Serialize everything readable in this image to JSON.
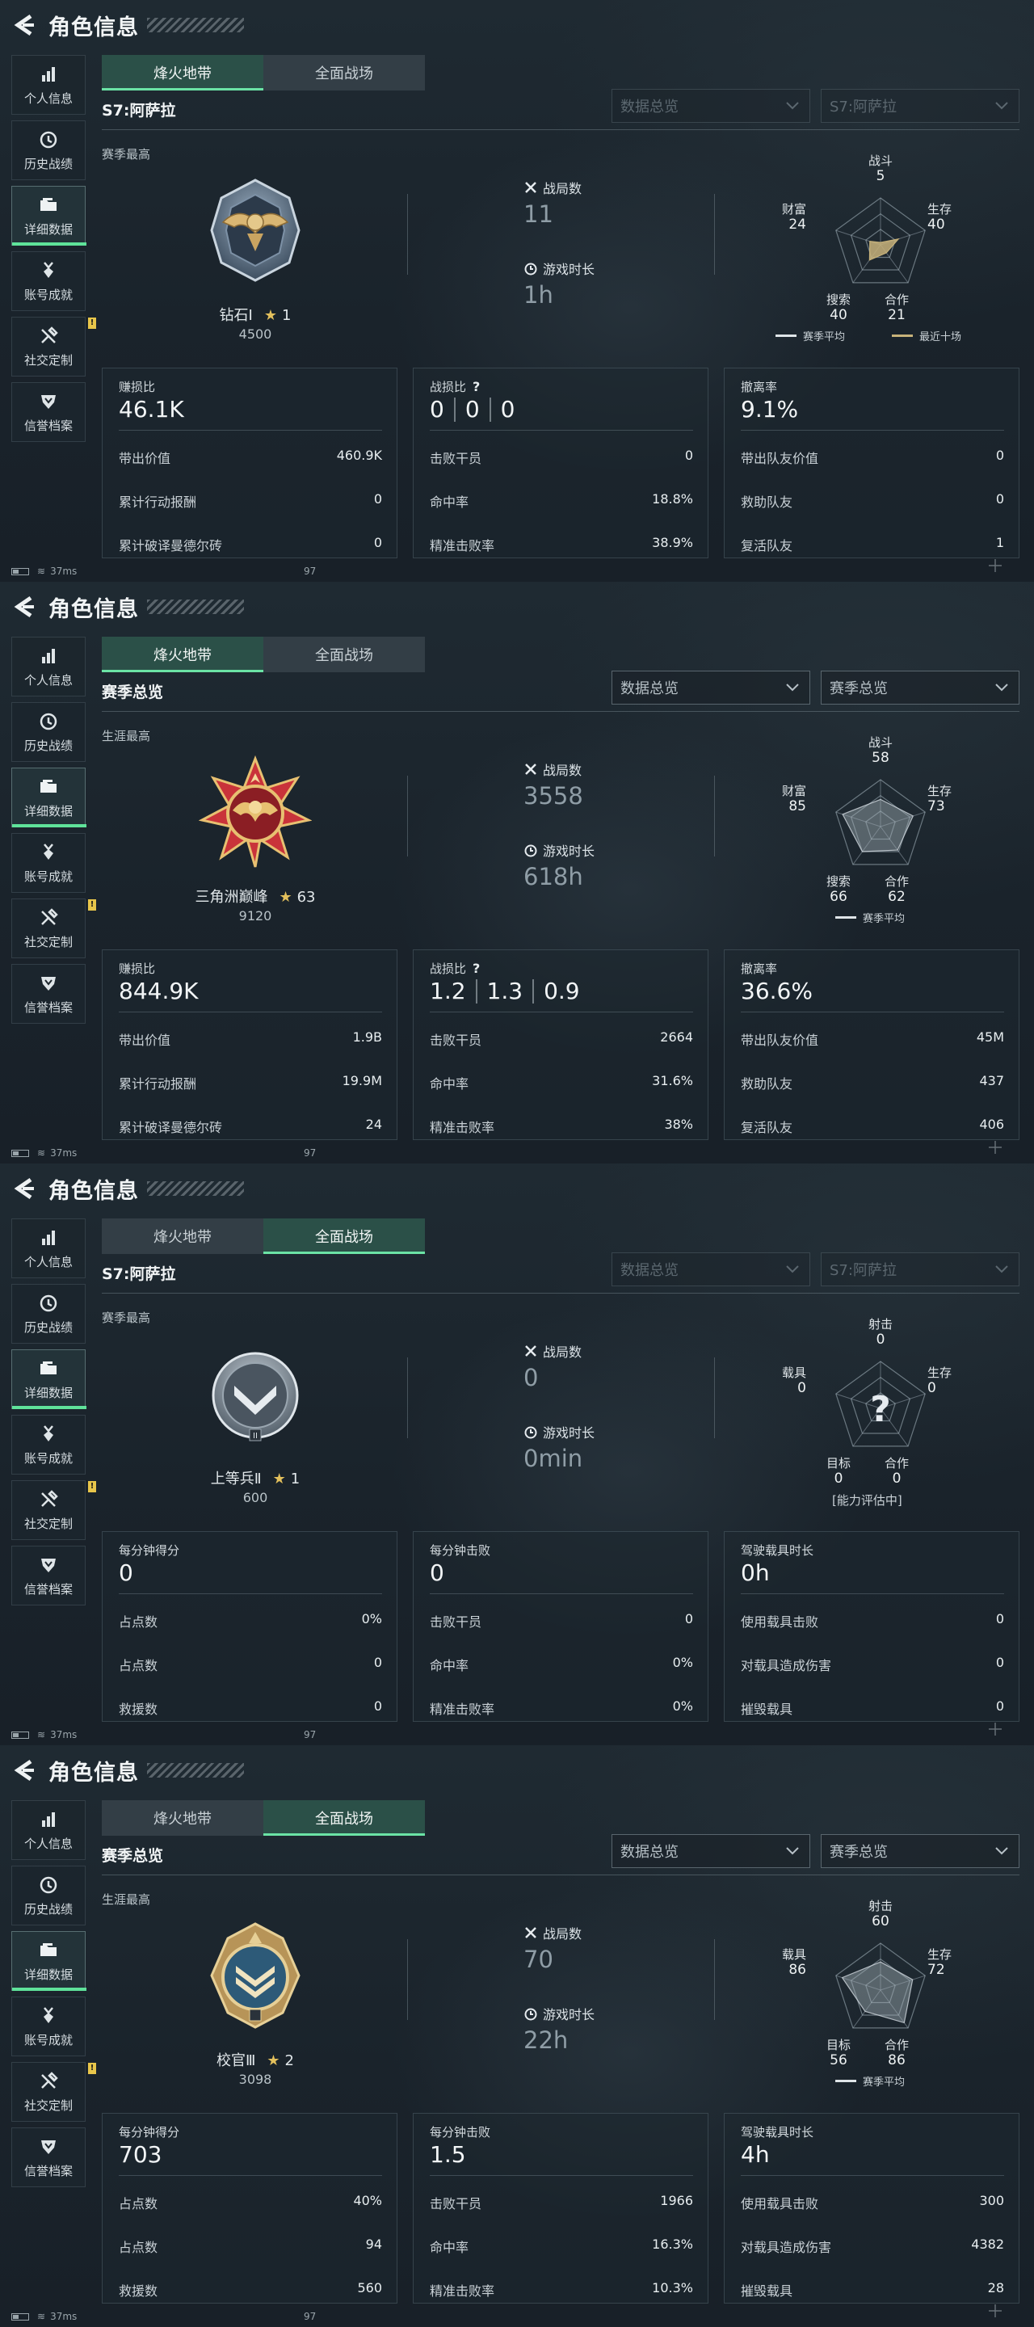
{
  "panels": [
    {
      "title": "角色信息",
      "sidebar": [
        "个人信息",
        "历史战绩",
        "详细数据",
        "账号成就",
        "社交定制",
        "信誉档案"
      ],
      "tabs": [
        "烽火地带",
        "全面战场"
      ],
      "subheader": "S7:阿萨拉",
      "dropdowns": [
        "数据总览",
        "S7:阿萨拉"
      ],
      "best_label": "赛季最高",
      "rank_name": "钻石Ⅰ",
      "rank_stars": "1",
      "rank_score": "4500",
      "stat1_label": "战局数",
      "stat1_value": "11",
      "stat2_label": "游戏时长",
      "stat2_value": "1h",
      "radar": {
        "top": "战斗",
        "top_v": "5",
        "right": "生存",
        "right_v": "40",
        "bottom_right": "合作",
        "bottom_right_v": "21",
        "bottom_left": "搜索",
        "bottom_left_v": "40",
        "left": "财富",
        "left_v": "24"
      },
      "legend1": "赛季平均",
      "legend2": "最近十场",
      "cards": [
        {
          "title": "赚损比",
          "value": "46.1K",
          "rows": [
            [
              "带出价值",
              "460.9K"
            ],
            [
              "累计行动报酬",
              "0"
            ],
            [
              "累计破译曼德尔砖",
              "0"
            ]
          ]
        },
        {
          "title": "战损比",
          "v1": "0",
          "v2": "0",
          "v3": "0",
          "rows": [
            [
              "击败干员",
              "0"
            ],
            [
              "命中率",
              "18.8%"
            ],
            [
              "精准击败率",
              "38.9%"
            ]
          ]
        },
        {
          "title": "撤离率",
          "value": "9.1%",
          "rows": [
            [
              "带出队友价值",
              "0"
            ],
            [
              "救助队友",
              "0"
            ],
            [
              "复活队友",
              "1"
            ]
          ]
        }
      ],
      "status_ping": "37ms",
      "status_num": "97"
    },
    {
      "title": "角色信息",
      "sidebar": [
        "个人信息",
        "历史战绩",
        "详细数据",
        "账号成就",
        "社交定制",
        "信誉档案"
      ],
      "tabs": [
        "烽火地带",
        "全面战场"
      ],
      "subheader": "赛季总览",
      "dropdowns": [
        "数据总览",
        "赛季总览"
      ],
      "best_label": "生涯最高",
      "rank_name": "三角洲巅峰",
      "rank_stars": "63",
      "rank_score": "9120",
      "stat1_label": "战局数",
      "stat1_value": "3558",
      "stat2_label": "游戏时长",
      "stat2_value": "618h",
      "radar": {
        "top": "战斗",
        "top_v": "58",
        "right": "生存",
        "right_v": "73",
        "bottom_right": "合作",
        "bottom_right_v": "62",
        "bottom_left": "搜索",
        "bottom_left_v": "66",
        "left": "财富",
        "left_v": "85"
      },
      "legend1": "赛季平均",
      "cards": [
        {
          "title": "赚损比",
          "value": "844.9K",
          "rows": [
            [
              "带出价值",
              "1.9B"
            ],
            [
              "累计行动报酬",
              "19.9M"
            ],
            [
              "累计破译曼德尔砖",
              "24"
            ]
          ]
        },
        {
          "title": "战损比",
          "v1": "1.2",
          "v2": "1.3",
          "v3": "0.9",
          "rows": [
            [
              "击败干员",
              "2664"
            ],
            [
              "命中率",
              "31.6%"
            ],
            [
              "精准击败率",
              "38%"
            ]
          ]
        },
        {
          "title": "撤离率",
          "value": "36.6%",
          "rows": [
            [
              "带出队友价值",
              "45M"
            ],
            [
              "救助队友",
              "437"
            ],
            [
              "复活队友",
              "406"
            ]
          ]
        }
      ],
      "status_ping": "37ms",
      "status_num": "97"
    },
    {
      "title": "角色信息",
      "sidebar": [
        "个人信息",
        "历史战绩",
        "详细数据",
        "账号成就",
        "社交定制",
        "信誉档案"
      ],
      "tabs": [
        "烽火地带",
        "全面战场"
      ],
      "subheader": "S7:阿萨拉",
      "dropdowns": [
        "数据总览",
        "S7:阿萨拉"
      ],
      "best_label": "赛季最高",
      "rank_name": "上等兵Ⅱ",
      "rank_stars": "1",
      "rank_score": "600",
      "stat1_label": "战局数",
      "stat1_value": "0",
      "stat2_label": "游戏时长",
      "stat2_value": "0min",
      "radar": {
        "top": "射击",
        "top_v": "0",
        "right": "生存",
        "right_v": "0",
        "bottom_right": "合作",
        "bottom_right_v": "0",
        "bottom_left": "目标",
        "bottom_left_v": "0",
        "left": "载具",
        "left_v": "0"
      },
      "radar_note": "[能力评估中]",
      "cards": [
        {
          "title": "每分钟得分",
          "value": "0",
          "rows": [
            [
              "占点数",
              "0%"
            ],
            [
              "占点数",
              "0"
            ],
            [
              "救援数",
              "0"
            ]
          ]
        },
        {
          "title": "每分钟击败",
          "value": "0",
          "rows": [
            [
              "击败干员",
              "0"
            ],
            [
              "命中率",
              "0%"
            ],
            [
              "精准击败率",
              "0%"
            ]
          ]
        },
        {
          "title": "驾驶载具时长",
          "value": "0h",
          "rows": [
            [
              "使用载具击败",
              "0"
            ],
            [
              "对载具造成伤害",
              "0"
            ],
            [
              "摧毁载具",
              "0"
            ]
          ]
        }
      ],
      "status_ping": "37ms",
      "status_num": "97"
    },
    {
      "title": "角色信息",
      "sidebar": [
        "个人信息",
        "历史战绩",
        "详细数据",
        "账号成就",
        "社交定制",
        "信誉档案"
      ],
      "tabs": [
        "烽火地带",
        "全面战场"
      ],
      "subheader": "赛季总览",
      "dropdowns": [
        "数据总览",
        "赛季总览"
      ],
      "best_label": "生涯最高",
      "rank_name": "校官Ⅲ",
      "rank_stars": "2",
      "rank_score": "3098",
      "stat1_label": "战局数",
      "stat1_value": "70",
      "stat2_label": "游戏时长",
      "stat2_value": "22h",
      "radar": {
        "top": "射击",
        "top_v": "60",
        "right": "生存",
        "right_v": "72",
        "bottom_right": "合作",
        "bottom_right_v": "86",
        "bottom_left": "目标",
        "bottom_left_v": "56",
        "left": "载具",
        "left_v": "86"
      },
      "legend1": "赛季平均",
      "cards": [
        {
          "title": "每分钟得分",
          "value": "703",
          "rows": [
            [
              "占点数",
              "40%"
            ],
            [
              "占点数",
              "94"
            ],
            [
              "救援数",
              "560"
            ]
          ]
        },
        {
          "title": "每分钟击败",
          "value": "1.5",
          "rows": [
            [
              "击败干员",
              "1966"
            ],
            [
              "命中率",
              "16.3%"
            ],
            [
              "精准击败率",
              "10.3%"
            ]
          ]
        },
        {
          "title": "驾驶载具时长",
          "value": "4h",
          "rows": [
            [
              "使用载具击败",
              "300"
            ],
            [
              "对载具造成伤害",
              "4382"
            ],
            [
              "摧毁载具",
              "28"
            ]
          ]
        }
      ],
      "status_ping": "37ms",
      "status_num": "97"
    }
  ],
  "colors": {
    "accent": "#5fe39a",
    "tab_active": "#2c524a",
    "radar_recent": "#c7b27a",
    "star": "#e3c05c"
  },
  "icons": [
    "back-arrow-icon",
    "bar-chart-icon",
    "clock-icon",
    "folder-icon",
    "medal-icon",
    "wrench-icon",
    "shield-icon",
    "crossed-swords-icon",
    "timer-icon",
    "question-icon"
  ]
}
